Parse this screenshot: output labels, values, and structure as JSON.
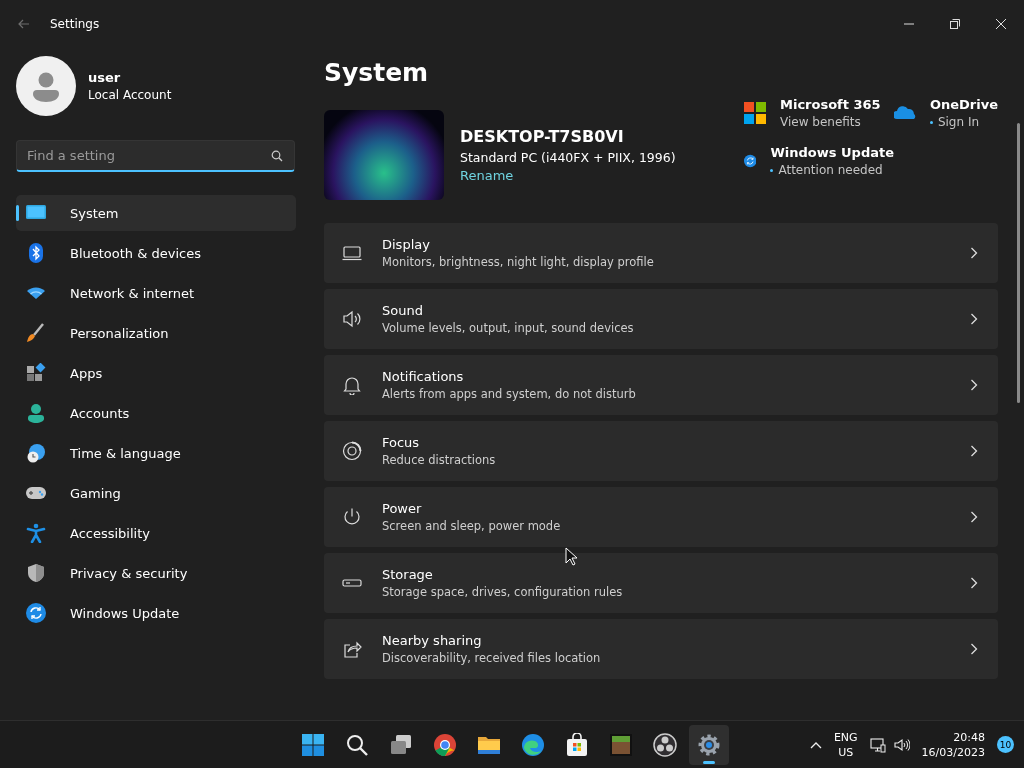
{
  "window": {
    "title": "Settings"
  },
  "user": {
    "name": "user",
    "account": "Local Account"
  },
  "search": {
    "placeholder": "Find a setting"
  },
  "nav": [
    {
      "label": "System",
      "selected": true
    },
    {
      "label": "Bluetooth & devices",
      "selected": false
    },
    {
      "label": "Network & internet",
      "selected": false
    },
    {
      "label": "Personalization",
      "selected": false
    },
    {
      "label": "Apps",
      "selected": false
    },
    {
      "label": "Accounts",
      "selected": false
    },
    {
      "label": "Time & language",
      "selected": false
    },
    {
      "label": "Gaming",
      "selected": false
    },
    {
      "label": "Accessibility",
      "selected": false
    },
    {
      "label": "Privacy & security",
      "selected": false
    },
    {
      "label": "Windows Update",
      "selected": false
    }
  ],
  "page_title": "System",
  "device": {
    "name": "DESKTOP-T7SB0VI",
    "model": "Standard PC (i440FX + PIIX, 1996)",
    "rename": "Rename"
  },
  "services": [
    {
      "title": "Microsoft 365",
      "subtitle": "View benefits",
      "alert": false
    },
    {
      "title": "OneDrive",
      "subtitle": "Sign In",
      "alert": true
    },
    {
      "title": "Windows Update",
      "subtitle": "Attention needed",
      "alert": true
    }
  ],
  "settings": [
    {
      "title": "Display",
      "subtitle": "Monitors, brightness, night light, display profile"
    },
    {
      "title": "Sound",
      "subtitle": "Volume levels, output, input, sound devices"
    },
    {
      "title": "Notifications",
      "subtitle": "Alerts from apps and system, do not disturb"
    },
    {
      "title": "Focus",
      "subtitle": "Reduce distractions"
    },
    {
      "title": "Power",
      "subtitle": "Screen and sleep, power mode"
    },
    {
      "title": "Storage",
      "subtitle": "Storage space, drives, configuration rules"
    },
    {
      "title": "Nearby sharing",
      "subtitle": "Discoverability, received files location"
    }
  ],
  "taskbar": {
    "apps": [
      {
        "selected": false
      },
      {
        "selected": false
      },
      {
        "selected": false
      },
      {
        "selected": false
      },
      {
        "selected": false
      },
      {
        "selected": false
      },
      {
        "selected": false
      },
      {
        "selected": false
      },
      {
        "selected": false
      },
      {
        "selected": true
      }
    ],
    "language": "ENG",
    "region": "US",
    "time": "20:48",
    "date": "16/03/2023",
    "notifications": "10"
  }
}
